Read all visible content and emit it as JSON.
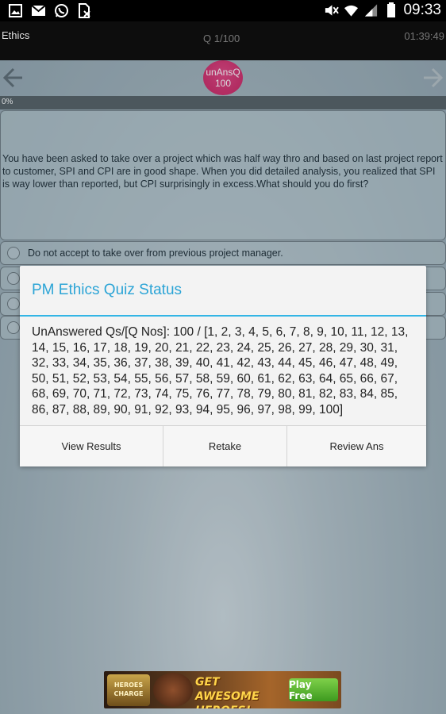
{
  "status_bar": {
    "time": "09:33",
    "left_icons": [
      "gallery-icon",
      "gmail-icon",
      "whatsapp-icon",
      "file-blocked-icon"
    ],
    "right_icons": [
      "mute-icon",
      "wifi-icon",
      "signal-icon",
      "battery-icon"
    ]
  },
  "topbar": {
    "title": "Ethics",
    "question_counter": "Q 1/100",
    "timer": "01:39:49"
  },
  "navigation": {
    "prev_icon": "arrow-left-icon",
    "next_icon": "arrow-right-icon"
  },
  "unanswered_badge": {
    "label": "unAnsQ",
    "count": "100"
  },
  "progress": {
    "label": "0%",
    "value": 0
  },
  "question": {
    "text": "You have been asked to take over a project which was half way thro and based on last project report to customer, SPI and CPI are in good shape. When you did detailed analysis, you realized that SPI is way lower than reported, but CPI surprisingly in excess.What should you do first?"
  },
  "options": [
    {
      "label": "Do not accept to take over from previous project manager."
    },
    {
      "label": ""
    },
    {
      "label": ""
    },
    {
      "label": ""
    }
  ],
  "dialog": {
    "title": "PM Ethics Quiz Status",
    "body": "UnAnswered Qs/[Q Nos]:   100  /  [1, 2, 3, 4, 5, 6, 7, 8, 9, 10, 11, 12, 13, 14, 15, 16, 17, 18, 19, 20, 21, 22, 23, 24, 25, 26, 27, 28, 29, 30, 31, 32, 33, 34, 35, 36, 37, 38, 39, 40, 41, 42, 43, 44, 45, 46, 47, 48, 49, 50, 51, 52, 53, 54, 55, 56, 57, 58, 59, 60, 61, 62, 63, 64, 65, 66, 67, 68, 69, 70, 71, 72, 73, 74, 75, 76, 77, 78, 79, 80, 81, 82, 83, 84, 85, 86, 87, 88, 89, 90, 91, 92, 93, 94, 95, 96, 97, 98, 99, 100]",
    "buttons": [
      "View Results",
      "Retake",
      "Review Ans"
    ]
  },
  "ad": {
    "logo_text": "HEROES CHARGE",
    "headline": "GET AWESOME HEROES!",
    "cta": "Play Free"
  }
}
